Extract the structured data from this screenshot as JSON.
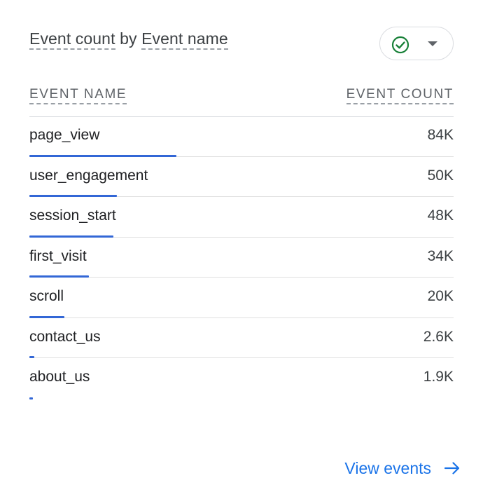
{
  "card": {
    "title_prefix": "Event count",
    "title_by": " by ",
    "title_suffix": "Event name",
    "filter_icon": "check-circle-icon",
    "filter_dropdown_icon": "caret-down-icon"
  },
  "table": {
    "col_name": "EVENT NAME",
    "col_count": "EVENT COUNT",
    "rows": [
      {
        "name": "page_view",
        "count_label": "84K",
        "count": 84000
      },
      {
        "name": "user_engagement",
        "count_label": "50K",
        "count": 50000
      },
      {
        "name": "session_start",
        "count_label": "48K",
        "count": 48000
      },
      {
        "name": "first_visit",
        "count_label": "34K",
        "count": 34000
      },
      {
        "name": "scroll",
        "count_label": "20K",
        "count": 20000
      },
      {
        "name": "contact_us",
        "count_label": "2.6K",
        "count": 2600
      },
      {
        "name": "about_us",
        "count_label": "1.9K",
        "count": 1900
      }
    ]
  },
  "footer": {
    "link_label": "View events",
    "link_icon": "arrow-right-icon"
  },
  "colors": {
    "bar": "#3367d6",
    "link": "#1a73e8",
    "check": "#188038"
  }
}
